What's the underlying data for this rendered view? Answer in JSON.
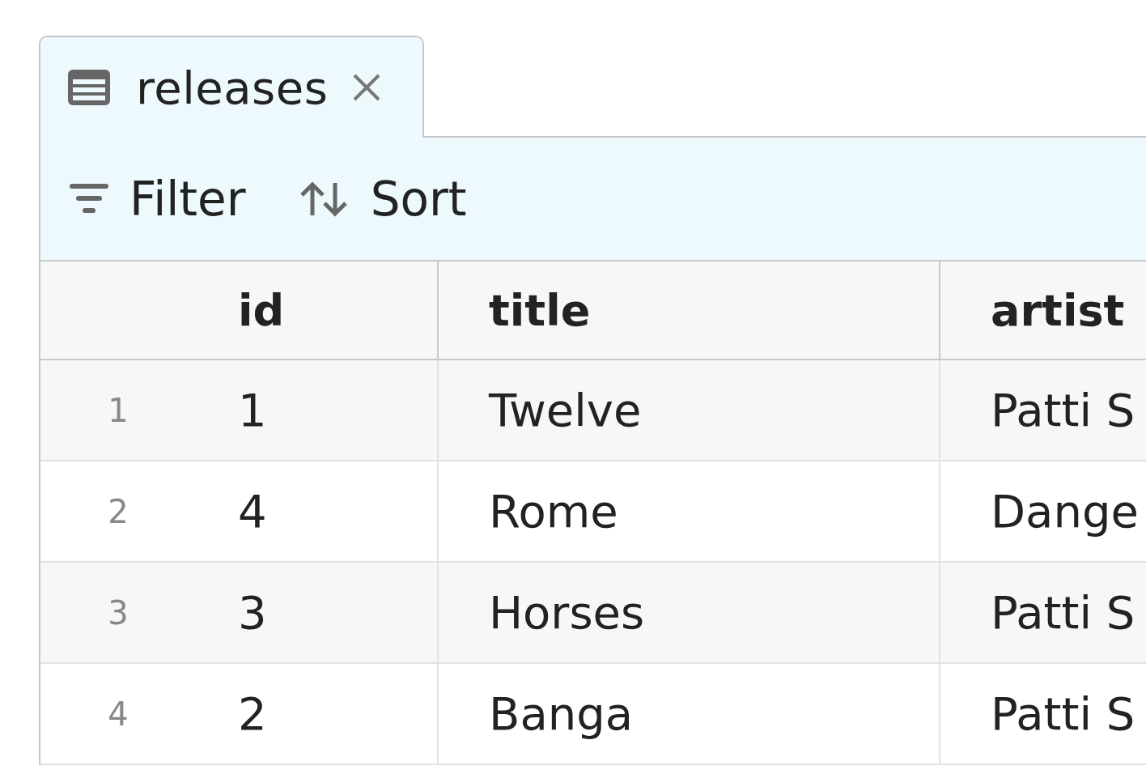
{
  "tabs": [
    {
      "label": "releases",
      "selected": true
    }
  ],
  "toolbar": [
    {
      "kind": "filter",
      "label": "Filter"
    },
    {
      "kind": "sort",
      "label": "Sort"
    }
  ],
  "table": {
    "columns": [
      "id",
      "title",
      "artist"
    ],
    "rows": [
      {
        "number": "1",
        "cells": [
          "1",
          "Twelve",
          "Patti S"
        ]
      },
      {
        "number": "2",
        "cells": [
          "4",
          "Rome",
          "Dange"
        ]
      },
      {
        "number": "3",
        "cells": [
          "3",
          "Horses",
          "Patti S"
        ]
      },
      {
        "number": "4",
        "cells": [
          "2",
          "Banga",
          "Patti S"
        ]
      }
    ]
  }
}
